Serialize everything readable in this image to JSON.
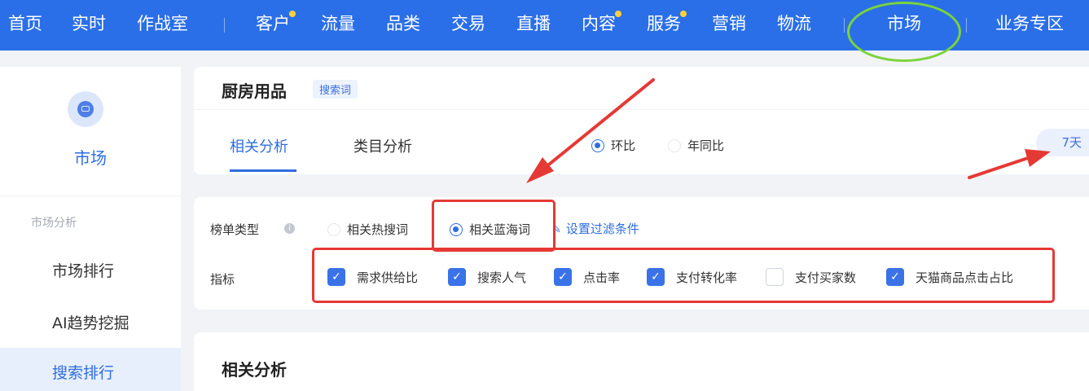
{
  "nav": {
    "items": [
      {
        "label": "首页",
        "dot": false
      },
      {
        "label": "实时",
        "dot": false
      },
      {
        "label": "作战室",
        "dot": false
      },
      {
        "label": "客户",
        "dot": true
      },
      {
        "label": "流量",
        "dot": false
      },
      {
        "label": "品类",
        "dot": false
      },
      {
        "label": "交易",
        "dot": false
      },
      {
        "label": "直播",
        "dot": false
      },
      {
        "label": "内容",
        "dot": true
      },
      {
        "label": "服务",
        "dot": true
      },
      {
        "label": "营销",
        "dot": false
      },
      {
        "label": "物流",
        "dot": false
      },
      {
        "label": "市场",
        "dot": false,
        "active": true
      },
      {
        "label": "业务专区",
        "dot": false
      }
    ],
    "accent": "#2a6fe8",
    "badge_color": "#ffd23c",
    "highlight_ring_color": "#7ad43a"
  },
  "sidebar": {
    "title": "市场",
    "icon": "market-icon",
    "group_label": "市场分析",
    "items": [
      {
        "label": "市场排行",
        "active": false
      },
      {
        "label": "AI趋势挖掘",
        "active": false
      },
      {
        "label": "搜索排行",
        "active": true
      }
    ]
  },
  "header": {
    "title": "厨房用品",
    "tag": "搜索词"
  },
  "tabs": [
    {
      "label": "相关分析",
      "active": true
    },
    {
      "label": "类目分析",
      "active": false
    }
  ],
  "compare": {
    "options": [
      {
        "label": "环比",
        "selected": true
      },
      {
        "label": "年同比",
        "selected": false
      }
    ]
  },
  "period": {
    "label": "7天"
  },
  "filters": {
    "list_type_label": "榜单类型",
    "list_types": [
      {
        "label": "相关热搜词",
        "selected": false
      },
      {
        "label": "相关蓝海词",
        "selected": true
      }
    ],
    "filter_link": "设置过滤条件",
    "metric_label": "指标",
    "metrics": [
      {
        "label": "需求供给比",
        "checked": true
      },
      {
        "label": "搜索人气",
        "checked": true
      },
      {
        "label": "点击率",
        "checked": true
      },
      {
        "label": "支付转化率",
        "checked": true
      },
      {
        "label": "支付买家数",
        "checked": false
      },
      {
        "label": "天猫商品点击占比",
        "checked": true
      }
    ]
  },
  "section": {
    "title": "相关分析"
  },
  "annotation_color": "#e53935"
}
